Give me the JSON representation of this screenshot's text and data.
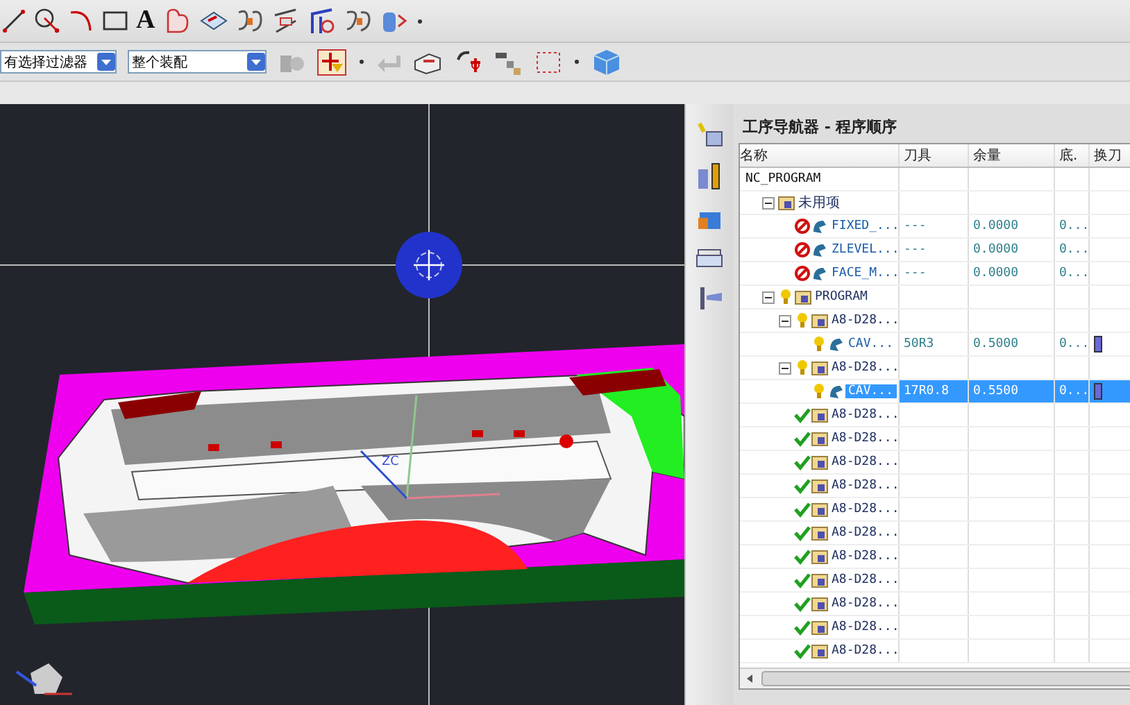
{
  "toolbar": {
    "text_tool": "A",
    "filter_dropdown": "有选择过滤器",
    "scope_dropdown": "整个装配"
  },
  "viewport": {
    "axis_label": "ZC"
  },
  "navigator": {
    "title": "工序导航器 - 程序顺序",
    "columns": [
      "名称",
      "刀具",
      "余量",
      "底.",
      "换刀"
    ],
    "tree": [
      {
        "name": "NC_PROGRAM",
        "kind": "root",
        "blocked": false,
        "regenerate": false,
        "complete": false,
        "selected": false,
        "children": [
          {
            "name": "未用项",
            "kind": "group",
            "blocked": false,
            "regenerate": false,
            "complete": false,
            "expanded": true,
            "selected": false,
            "children": [
              {
                "name": "FIXED_...",
                "kind": "operation",
                "blocked": true,
                "regenerate": false,
                "complete": false,
                "tool": "---",
                "stock": "0.0000",
                "floor": "0...",
                "tool_change": false,
                "selected": false
              },
              {
                "name": "ZLEVEL...",
                "kind": "operation",
                "blocked": true,
                "regenerate": false,
                "complete": false,
                "tool": "---",
                "stock": "0.0000",
                "floor": "0...",
                "tool_change": false,
                "selected": false
              },
              {
                "name": "FACE_M...",
                "kind": "operation",
                "blocked": true,
                "regenerate": false,
                "complete": false,
                "tool": "---",
                "stock": "0.0000",
                "floor": "0...",
                "tool_change": false,
                "selected": false
              }
            ]
          },
          {
            "name": "PROGRAM",
            "kind": "group",
            "blocked": false,
            "regenerate": true,
            "complete": false,
            "expanded": true,
            "selected": false,
            "children": [
              {
                "name": "A8-D28...",
                "kind": "group",
                "blocked": false,
                "regenerate": true,
                "complete": false,
                "expanded": true,
                "selected": false,
                "children": [
                  {
                    "name": "CAV...",
                    "kind": "operation",
                    "blocked": false,
                    "regenerate": true,
                    "complete": false,
                    "tool": "50R3",
                    "stock": "0.5000",
                    "floor": "0...",
                    "tool_change": true,
                    "selected": false
                  }
                ]
              },
              {
                "name": "A8-D28...",
                "kind": "group",
                "blocked": false,
                "regenerate": true,
                "complete": false,
                "expanded": true,
                "selected": false,
                "children": [
                  {
                    "name": "CAV...",
                    "kind": "operation",
                    "blocked": false,
                    "regenerate": true,
                    "complete": false,
                    "tool": "17R0.8",
                    "stock": "0.5500",
                    "floor": "0...",
                    "tool_change": true,
                    "selected": true
                  }
                ]
              },
              {
                "name": "A8-D28...",
                "kind": "group",
                "blocked": false,
                "regenerate": false,
                "complete": true,
                "selected": false
              },
              {
                "name": "A8-D28...",
                "kind": "group",
                "blocked": false,
                "regenerate": false,
                "complete": true,
                "selected": false
              },
              {
                "name": "A8-D28...",
                "kind": "group",
                "blocked": false,
                "regenerate": false,
                "complete": true,
                "selected": false
              },
              {
                "name": "A8-D28...",
                "kind": "group",
                "blocked": false,
                "regenerate": false,
                "complete": true,
                "selected": false
              },
              {
                "name": "A8-D28...",
                "kind": "group",
                "blocked": false,
                "regenerate": false,
                "complete": true,
                "selected": false
              },
              {
                "name": "A8-D28...",
                "kind": "group",
                "blocked": false,
                "regenerate": false,
                "complete": true,
                "selected": false
              },
              {
                "name": "A8-D28...",
                "kind": "group",
                "blocked": false,
                "regenerate": false,
                "complete": true,
                "selected": false
              },
              {
                "name": "A8-D28...",
                "kind": "group",
                "blocked": false,
                "regenerate": false,
                "complete": true,
                "selected": false
              },
              {
                "name": "A8-D28...",
                "kind": "group",
                "blocked": false,
                "regenerate": false,
                "complete": true,
                "selected": false
              },
              {
                "name": "A8-D28...",
                "kind": "group",
                "blocked": false,
                "regenerate": false,
                "complete": true,
                "selected": false
              },
              {
                "name": "A8-D28...",
                "kind": "group",
                "blocked": false,
                "regenerate": false,
                "complete": true,
                "selected": false
              }
            ]
          }
        ]
      }
    ]
  }
}
